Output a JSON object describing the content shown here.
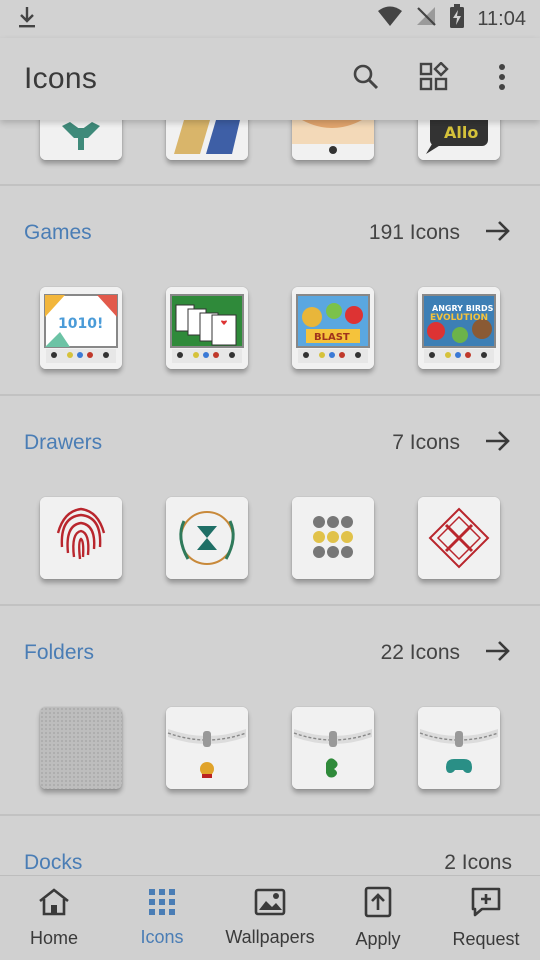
{
  "status_bar": {
    "time": "11:04",
    "icons": [
      "download-icon",
      "wifi-icon",
      "no-signal-icon",
      "battery-charging-icon"
    ]
  },
  "app_bar": {
    "title": "Icons",
    "actions": [
      "search-icon",
      "grid-shapes-icon",
      "more-vert-icon"
    ]
  },
  "sections": [
    {
      "name": "Games",
      "count": "191 Icons"
    },
    {
      "name": "Drawers",
      "count": "7 Icons"
    },
    {
      "name": "Folders",
      "count": "22 Icons"
    },
    {
      "name": "Docks",
      "count": "2 Icons"
    }
  ],
  "icon_tiles": {
    "top_partial": [
      "partial-icon-1",
      "partial-icon-2",
      "partial-icon-3",
      "partial-icon-allo"
    ],
    "games": [
      "1010-game-icon",
      "solitaire-game-icon",
      "angry-birds-blast-icon",
      "angry-birds-evolution-icon"
    ],
    "drawers": [
      "fingerprint-drawer-icon",
      "emblem-drawer-icon",
      "dots-grid-drawer-icon",
      "swords-drawer-icon"
    ],
    "folders": [
      "blank-folder-icon",
      "badge-folder-icon",
      "hand-folder-icon",
      "gamepad-folder-icon"
    ]
  },
  "partial_text": {
    "allo": "Allo"
  },
  "games_text": {
    "g1010": "1010!",
    "blast": "BLAST",
    "angry": "ANGRY BIRDS",
    "evolution": "EVOLUTION"
  },
  "bottom_nav": {
    "active": "Icons",
    "items": [
      {
        "label": "Home",
        "icon": "home-icon"
      },
      {
        "label": "Icons",
        "icon": "apps-grid-icon"
      },
      {
        "label": "Wallpapers",
        "icon": "image-icon"
      },
      {
        "label": "Apply",
        "icon": "apply-icon"
      },
      {
        "label": "Request",
        "icon": "request-icon"
      }
    ]
  },
  "colors": {
    "accent": "#4a7db5",
    "background": "#d2d2d2",
    "text": "#333333"
  }
}
